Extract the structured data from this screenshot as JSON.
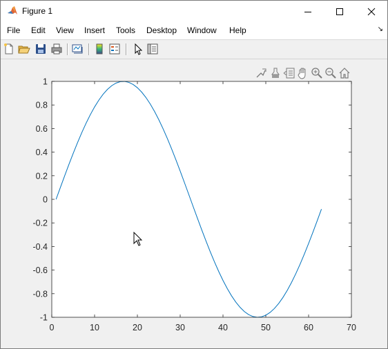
{
  "window": {
    "title": "Figure 1",
    "controls": {
      "minimize": "minimize",
      "maximize": "maximize",
      "close": "close"
    }
  },
  "menu": {
    "items": [
      "File",
      "Edit",
      "View",
      "Insert",
      "Tools",
      "Desktop",
      "Window",
      "Help"
    ]
  },
  "toolbar": {
    "buttons": [
      "new-figure-icon",
      "open-file-icon",
      "save-icon",
      "print-icon",
      "link-plot-icon",
      "insert-colorbar-icon",
      "insert-legend-icon",
      "edit-plot-icon",
      "property-inspector-icon"
    ]
  },
  "axes_toolbar": {
    "buttons": [
      "data-tips-icon",
      "brush-icon",
      "export-icon",
      "pan-icon",
      "zoom-in-icon",
      "zoom-out-icon",
      "home-icon"
    ]
  },
  "colors": {
    "line": "#0072bd",
    "axes_bg": "#ffffff",
    "figure_bg": "#f0f0f0"
  },
  "chart_data": {
    "type": "line",
    "title": "",
    "xlabel": "",
    "ylabel": "",
    "xlim": [
      0,
      70
    ],
    "ylim": [
      -1,
      1
    ],
    "xticks": [
      "0",
      "10",
      "20",
      "30",
      "40",
      "50",
      "60",
      "70"
    ],
    "yticks": [
      "-1",
      "-0.8",
      "-0.6",
      "-0.4",
      "-0.2",
      "0",
      "0.2",
      "0.4",
      "0.6",
      "0.8",
      "1"
    ],
    "grid": false,
    "series": [
      {
        "color": "#0072bd",
        "x": [
          1,
          2,
          3,
          4,
          5,
          6,
          7,
          8,
          9,
          10,
          11,
          12,
          13,
          14,
          15,
          16,
          17,
          18,
          19,
          20,
          21,
          22,
          23,
          24,
          25,
          26,
          27,
          28,
          29,
          30,
          31,
          32,
          33,
          34,
          35,
          36,
          37,
          38,
          39,
          40,
          41,
          42,
          43,
          44,
          45,
          46,
          47,
          48,
          49,
          50,
          51,
          52,
          53,
          54,
          55,
          56,
          57,
          58,
          59,
          60,
          61,
          62,
          63
        ],
        "y": [
          0.0,
          0.0998,
          0.1987,
          0.2955,
          0.3894,
          0.4794,
          0.5646,
          0.6442,
          0.7174,
          0.7833,
          0.8415,
          0.8912,
          0.932,
          0.9636,
          0.9854,
          0.9975,
          0.9996,
          0.9917,
          0.9738,
          0.9463,
          0.9093,
          0.8632,
          0.8085,
          0.7457,
          0.6755,
          0.5985,
          0.5155,
          0.4274,
          0.335,
          0.2392,
          0.1411,
          0.0416,
          -0.0584,
          -0.1577,
          -0.2555,
          -0.3508,
          -0.4425,
          -0.5298,
          -0.6119,
          -0.6878,
          -0.7568,
          -0.8183,
          -0.8716,
          -0.9162,
          -0.9516,
          -0.9775,
          -0.9937,
          -0.9999,
          -0.9962,
          -0.9825,
          -0.9589,
          -0.9258,
          -0.8835,
          -0.8323,
          -0.7728,
          -0.7055,
          -0.6313,
          -0.5507,
          -0.4646,
          -0.3739,
          -0.2794,
          -0.1822,
          -0.0831
        ]
      }
    ]
  }
}
